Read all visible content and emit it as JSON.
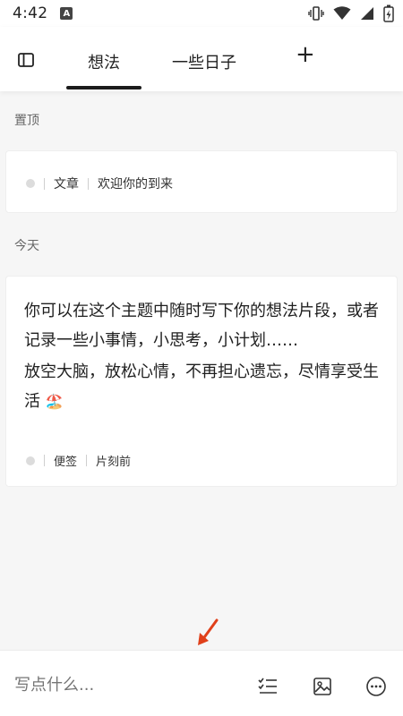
{
  "status_bar": {
    "time": "4:42",
    "app_badge": "A",
    "icons": [
      "vibrate-icon",
      "wifi-icon",
      "signal-icon",
      "battery-charging-icon"
    ]
  },
  "top_nav": {
    "tabs": [
      {
        "label": "想法",
        "active": true
      },
      {
        "label": "一些日子",
        "active": false
      }
    ],
    "add_label": "+"
  },
  "sections": {
    "pinned_label": "置顶",
    "today_label": "今天"
  },
  "pinned_card": {
    "type": "文章",
    "title": "欢迎你的到来"
  },
  "note_card": {
    "line1": "你可以在这个主题中随时写下你的想法片段，或者记录一些小事情，小思考，小计划……",
    "line2": "放空大脑，放松心情，不再担心遗忘，尽情享受生活",
    "emoji": "🏖️",
    "type": "便签",
    "time": "片刻前"
  },
  "composer": {
    "placeholder": "写点什么..."
  },
  "colors": {
    "background": "#f6f6f6",
    "card": "#ffffff",
    "indicator": "#1b1b1b",
    "annotation_arrow": "#e0401a"
  }
}
